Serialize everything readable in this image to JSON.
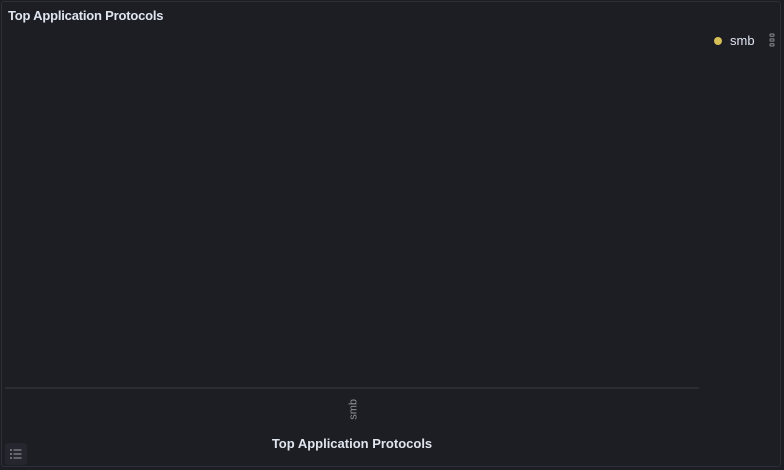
{
  "panel": {
    "title": "Top Application Protocols"
  },
  "legend": {
    "items": [
      {
        "label": "smb",
        "color": "#d6bf57"
      }
    ]
  },
  "chart_data": {
    "type": "bar",
    "title": "Top Application Protocols",
    "xlabel": "Top Application Protocols",
    "ylabel": "",
    "categories": [
      "smb"
    ],
    "series": [
      {
        "name": "smb",
        "values": [
          0
        ],
        "color": "#d6bf57"
      }
    ],
    "legend_position": "top-right",
    "grid": false
  },
  "icons": {
    "legend_toggle": "list-icon",
    "legend_scroll": "more-vertical-icon"
  }
}
